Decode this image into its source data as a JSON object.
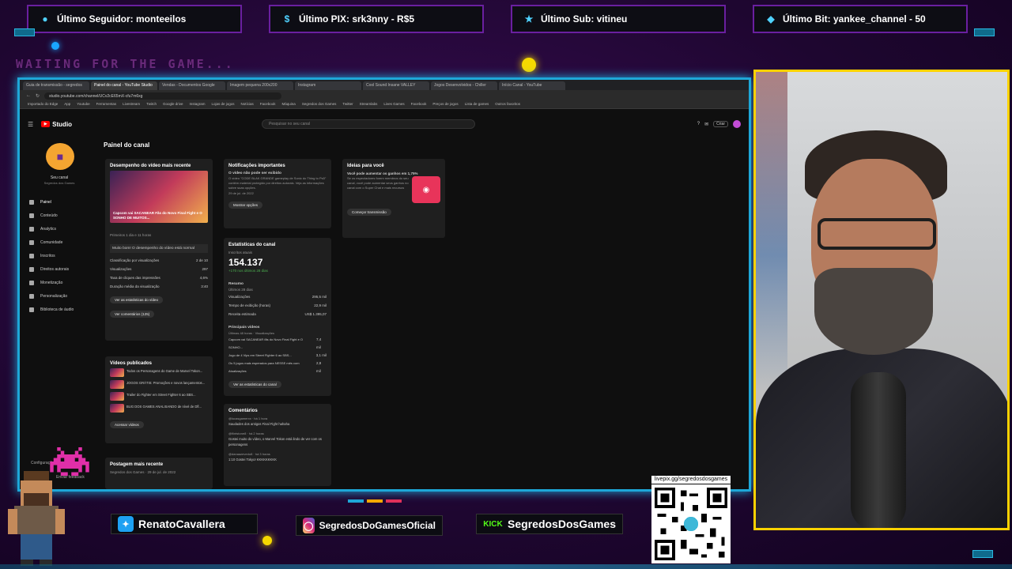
{
  "overlay": {
    "alerts": [
      {
        "label": "Último Seguidor: monteeilos",
        "icon": "person-icon"
      },
      {
        "label": "Último PIX: srk3nny - R$5",
        "icon": "dollar-icon"
      },
      {
        "label": "Último Sub: vitineu",
        "icon": "star-icon"
      },
      {
        "label": "Último Bit: yankee_channel - 50",
        "icon": "diamond-icon"
      }
    ],
    "waiting_text": "WAITING FOR THE GAME...",
    "socials": [
      {
        "label": "RenatoCavallera",
        "icon": "twitter-icon"
      },
      {
        "label": "SegredosDoGamesOficial",
        "icon": "instagram-icon"
      },
      {
        "label": "SegredosDosGames",
        "icon": "kick-icon",
        "prefix": "KICK"
      }
    ],
    "qr_url": "livepix.gg/segredosdosgames",
    "colors": {
      "accent_blue": "#1ea7d8",
      "cam_border": "#ffd200",
      "bg_purple": "#2a0a40"
    }
  },
  "browser": {
    "tabs": [
      "Guia de transmissão - segredos",
      "Painel do canal - YouTube Studio",
      "Vendas - Documentos Google",
      "Imagem pequena 200x200",
      "Instagram",
      "Cool Sound Insane VALLEY",
      "Jogos Desenvolvidos - Chiller",
      "Início Canal - YouTube"
    ],
    "url": "studio.youtube.com/channel/UCv2cE65mX-cfu7m6xg",
    "bookmarks": [
      "Importado do Edge",
      "App",
      "Youtube",
      "Ferramentas",
      "Livestream",
      "Twitch",
      "Google drive",
      "Instagram",
      "Lojas de jogos",
      "Notícias",
      "Facebook",
      "Máquina",
      "Segredos dos Games",
      "Twitter",
      "Streamlabs",
      "Lives Games",
      "Facebook",
      "Preços de jogos",
      "Lista de games",
      "Outros favoritos"
    ]
  },
  "studio": {
    "logo_text": "Studio",
    "search_placeholder": "Pesquisar no seu canal",
    "create_label": "Criar",
    "channel_name": "Seu canal",
    "channel_sub": "Segredos dos Games",
    "nav": [
      "Painel",
      "Conteúdo",
      "Analytics",
      "Comunidade",
      "Inscritos",
      "Direitos autorais",
      "Monetização",
      "Personalização",
      "Biblioteca de áudio"
    ],
    "settings_label": "Configurações",
    "feedback_label": "Enviar feedback",
    "dashboard_title": "Painel do canal",
    "video_perf": {
      "title": "Desempenho do vídeo mais recente",
      "video_title": "Capcom vai SACANEAR Fãs do Novo Final Fight e O SONHO DE MUITOS...",
      "window_note": "Primeiros 1 dia e 11 horas",
      "summary": "Muito bom! O desempenho do vídeo está normal",
      "rows": [
        {
          "label": "Classificação por visualizações",
          "value": "2 de 10"
        },
        {
          "label": "Visualizações",
          "value": "297"
        },
        {
          "label": "Taxa de cliques das impressões",
          "value": "4,6%"
        },
        {
          "label": "Duração média da visualização",
          "value": "3:40"
        }
      ],
      "btn_analytics": "Ver as estatísticas do vídeo",
      "btn_comments": "Ver comentários (125)"
    },
    "published": {
      "title": "Vídeos publicados",
      "items": [
        "Todos os Personagens do Game de Marvel Tokon...",
        "JOGOS GRÁTIS: Promoções e novos lançamentos...",
        "Trailer do Fighter em Street Fighter 6 ao SBS...",
        "BUG DOS GAMES ANALISANDO de nível de Dfl..."
      ],
      "btn_more": "Acessar vídeos"
    },
    "recent_post": {
      "title": "Postagem mais recente",
      "meta": "Segredos dos Games · 29 de jul. de 2022"
    },
    "notifications": {
      "title": "Notificações importantes",
      "headline": "O vídeo não pode ser exibido",
      "body": "O vídeo \"CODE BLAK GRANDE gameplay de Sonic do Thing to Ps5\" contém material protegido por direitos autorais. Veja as informações sobre suas opções.",
      "date": "29 de jul. de 2022",
      "btn": "Mostrar opções"
    },
    "stats": {
      "title": "Estatísticas do canal",
      "current_label": "Inscritos atuais",
      "subscribers": "154.137",
      "delta": "+170 nos últimos 28 dias",
      "summary_title": "Resumo",
      "summary_sub": "Últimos 28 dias",
      "rows": [
        {
          "label": "Visualizações",
          "value": "295,5 mil"
        },
        {
          "label": "Tempo de exibição (horas)",
          "value": "22,9 mil"
        },
        {
          "label": "Receita estimada",
          "value": "US$ 1.395,07"
        }
      ],
      "top_title": "Principais vídeos",
      "top_sub": "Últimas 48 horas · Visualizações",
      "top_videos": [
        {
          "title": "Capcom vai SACANEAR fãs do Novo Final Fight e O SONHO...",
          "value": "7,4 mil"
        },
        {
          "title": "Jogo de 4 Vips em Street Fighter 6 ao SBS...",
          "value": "3,1 mil"
        },
        {
          "title": "Os 5 jogos mais esperados para NESSE mês com Atualizações",
          "value": "2,8 mil"
        }
      ],
      "btn": "Ver as estatísticas do canal"
    },
    "comments": {
      "title": "Comentários",
      "items": [
        {
          "author": "@lucasgamerxx · há 1 hora",
          "text": "Saudades dos antigos Final Fight hahaha"
        },
        {
          "author": "@flintstone8 · há 2 horas",
          "text": "Gostei muito do vídeo, o Marvel Tokon está lindo de ver com os personagens"
        },
        {
          "author": "@danaazevedo8 · há 3 horas",
          "text": "1:10 Gostei Tokyo! KKKKKKKKK"
        }
      ]
    },
    "ideas": {
      "title": "Ideias para você",
      "headline": "Você pode aumentar os ganhos em 1,75%",
      "body": "Se os espectadores forem membros do seu canal, você pode aumentar seus ganhos no canal com o Super Chat e mais recursos",
      "btn": "Começar transmissão"
    }
  }
}
